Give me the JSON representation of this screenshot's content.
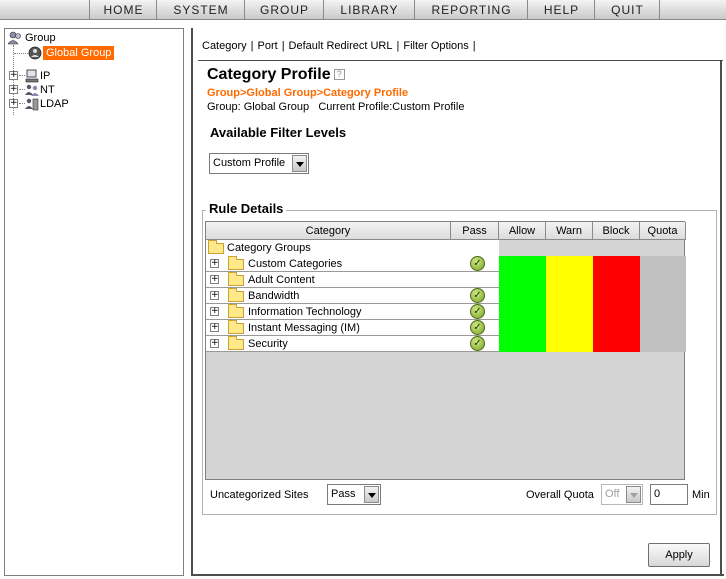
{
  "menu": {
    "items": [
      "HOME",
      "SYSTEM",
      "GROUP",
      "LIBRARY",
      "REPORTING",
      "HELP",
      "QUIT"
    ]
  },
  "tree": {
    "root_label": "Group",
    "selected_label": "Global Group",
    "nodes": [
      "IP",
      "NT",
      "LDAP"
    ]
  },
  "tabs": [
    "Category",
    "Port",
    "Default Redirect URL",
    "Filter Options"
  ],
  "page": {
    "title": "Category Profile",
    "breadcrumb": "Group>Global Group>Category Profile",
    "group_label": "Group:",
    "group_value": "Global Group",
    "profile_label": "Current Profile:",
    "profile_value": "Custom Profile"
  },
  "filter_levels": {
    "heading": "Available Filter Levels",
    "selected": "Custom Profile"
  },
  "rule_details": {
    "legend": "Rule Details",
    "columns": [
      "Category",
      "Pass",
      "Allow",
      "Warn",
      "Block",
      "Quota"
    ],
    "group_header": "Category Groups",
    "rows": [
      {
        "label": "Custom Categories",
        "pass": true
      },
      {
        "label": "Adult Content",
        "pass": false
      },
      {
        "label": "Bandwidth",
        "pass": true
      },
      {
        "label": "Information Technology",
        "pass": true
      },
      {
        "label": "Instant Messaging (IM)",
        "pass": true
      },
      {
        "label": "Security",
        "pass": true
      }
    ],
    "column_colors": {
      "allow": "#00ff00",
      "warn": "#ffff00",
      "block": "#ff0000",
      "quota": "#c0c0c0"
    }
  },
  "bottom": {
    "uncategorized_label": "Uncategorized Sites",
    "uncategorized_value": "Pass",
    "overall_quota_label": "Overall Quota",
    "overall_quota_value": "Off",
    "minutes_value": "0",
    "minutes_unit": "Min"
  },
  "apply_label": "Apply",
  "icons": {
    "tree_root": "group-icon",
    "selected": "global-group-icon",
    "ip": "computer-icon",
    "nt": "users-icon",
    "ldap": "directory-icon",
    "pass": "checkmark-icon",
    "folder": "folder-icon",
    "help": "help-icon"
  },
  "colors": {
    "accent": "#ff6a00"
  }
}
